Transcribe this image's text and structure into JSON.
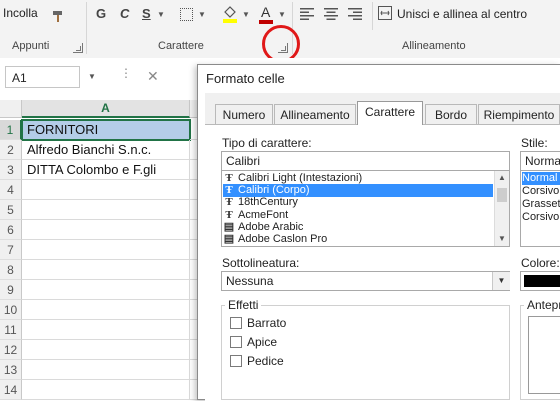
{
  "ribbon": {
    "font_group": {
      "paste_label": "Incolla",
      "bold": "G",
      "italic": "C",
      "underline": "S",
      "group_label": "Carattere",
      "font_color": "#c00000",
      "fill_color": "#ffff00"
    },
    "clipboard_group": {
      "group_label": "Appunti"
    },
    "alignment_group": {
      "group_label": "Allineamento",
      "merge_label": "Unisci e allinea al centro"
    }
  },
  "formula_bar": {
    "name_box": "A1",
    "cancel_icon": "✕"
  },
  "sheet": {
    "column_header": "A",
    "rows": [
      {
        "num": "1",
        "value": "FORNITORI",
        "selected": true
      },
      {
        "num": "2",
        "value": "Alfredo Bianchi S.n.c."
      },
      {
        "num": "3",
        "value": "DITTA Colombo e F.gli"
      },
      {
        "num": "4",
        "value": ""
      },
      {
        "num": "5",
        "value": ""
      },
      {
        "num": "6",
        "value": ""
      },
      {
        "num": "7",
        "value": ""
      },
      {
        "num": "8",
        "value": ""
      },
      {
        "num": "9",
        "value": ""
      },
      {
        "num": "10",
        "value": ""
      },
      {
        "num": "11",
        "value": ""
      },
      {
        "num": "12",
        "value": ""
      },
      {
        "num": "13",
        "value": ""
      },
      {
        "num": "14",
        "value": ""
      }
    ]
  },
  "annotation": {
    "circle_color": "#e01818"
  },
  "dialog": {
    "title": "Formato celle",
    "tabs": [
      "Numero",
      "Allineamento",
      "Carattere",
      "Bordo",
      "Riempimento"
    ],
    "active_tab": "Carattere",
    "font_label": "Tipo di carattere:",
    "font_value": "Calibri",
    "font_list": [
      "Calibri Light (Intestazioni)",
      "Calibri (Corpo)",
      "18thCentury",
      "AcmeFont",
      "Adobe Arabic",
      "Adobe Caslon Pro"
    ],
    "font_list_selected": "Calibri (Corpo)",
    "style_label": "Stile:",
    "style_value": "Normal",
    "style_list": [
      "Normal",
      "Corsivo",
      "Grasset",
      "Corsivo"
    ],
    "underline_label": "Sottolineatura:",
    "underline_value": "Nessuna",
    "color_label": "Colore:",
    "color_value": "#000000",
    "effects_label": "Effetti",
    "effects": [
      "Barrato",
      "Apice",
      "Pedice"
    ],
    "preview_label": "Antepr"
  }
}
